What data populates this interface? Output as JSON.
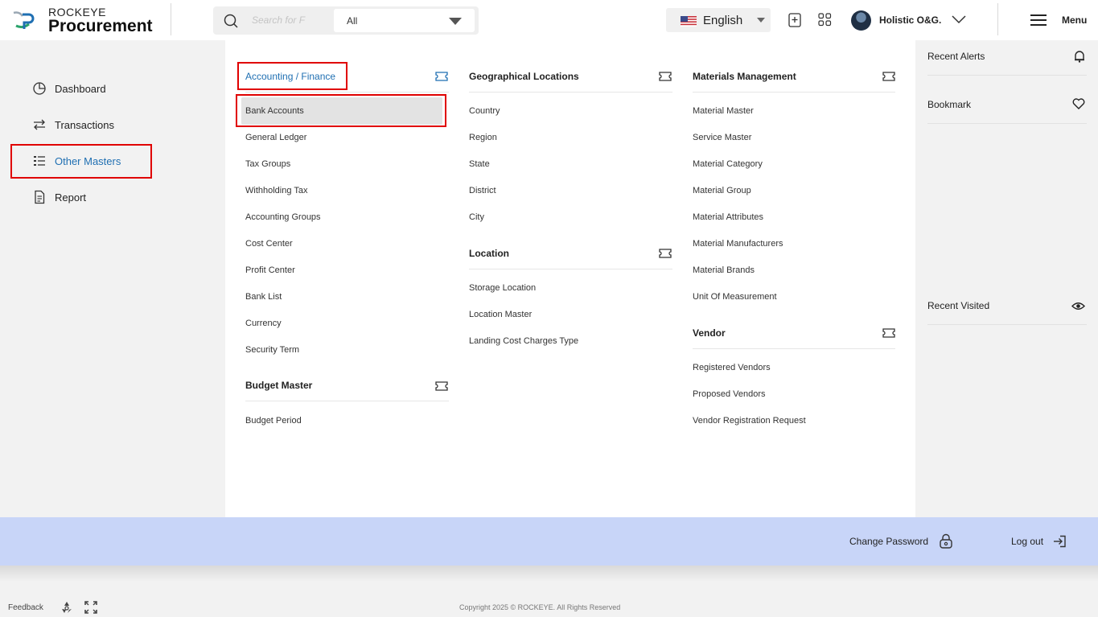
{
  "brand": {
    "top": "ROCKEYE",
    "main": "Procurement"
  },
  "search": {
    "placeholder": "Search for F",
    "filter_value": "All"
  },
  "language": {
    "label": "English"
  },
  "user": {
    "name": "Holistic O&G."
  },
  "menu_label": "Menu",
  "sidebar": {
    "items": [
      {
        "label": "Dashboard",
        "icon": "pie-chart-icon"
      },
      {
        "label": "Transactions",
        "icon": "arrows-swap-icon"
      },
      {
        "label": "Other Masters",
        "icon": "list-icon",
        "active": true
      },
      {
        "label": "Report",
        "icon": "document-icon"
      }
    ]
  },
  "mega_menu": {
    "accounting": {
      "title": "Accounting / Finance",
      "items": [
        "Bank Accounts",
        "General Ledger",
        "Tax Groups",
        "Withholding Tax",
        "Accounting Groups",
        "Cost Center",
        "Profit Center",
        "Bank List",
        "Currency",
        "Security Term"
      ]
    },
    "budget": {
      "title": "Budget Master",
      "items": [
        "Budget Period"
      ]
    },
    "geo": {
      "title": "Geographical Locations",
      "items": [
        "Country",
        "Region",
        "State",
        "District",
        "City"
      ]
    },
    "location": {
      "title": "Location",
      "items": [
        "Storage Location",
        "Location Master",
        "Landing Cost Charges Type"
      ]
    },
    "materials": {
      "title": "Materials Management",
      "items": [
        "Material Master",
        "Service Master",
        "Material Category",
        "Material Group",
        "Material Attributes",
        "Material Manufacturers",
        "Material Brands",
        "Unit Of Measurement"
      ]
    },
    "vendor": {
      "title": "Vendor",
      "items": [
        "Registered Vendors",
        "Proposed Vendors",
        "Vendor Registration Request"
      ]
    }
  },
  "rail": {
    "recent_alerts": "Recent Alerts",
    "bookmark": "Bookmark",
    "recent_visited": "Recent Visited"
  },
  "bottom_bar": {
    "change_password": "Change Password",
    "logout": "Log out"
  },
  "footer": {
    "feedback": "Feedback",
    "copyright": "Copyright 2025 © ROCKEYE. All Rights Reserved"
  },
  "colors": {
    "accent": "#1f6fb2",
    "highlight_border": "#e00000",
    "bottom_bar": "#c8d5f8"
  }
}
